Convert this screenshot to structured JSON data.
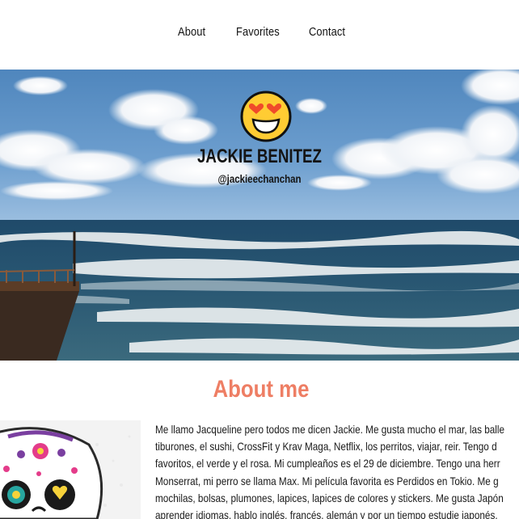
{
  "nav": {
    "items": [
      {
        "label": "About"
      },
      {
        "label": "Favorites"
      },
      {
        "label": "Contact"
      }
    ]
  },
  "hero": {
    "emoji": "heart-eyes-emoji",
    "name": "JACKIE BENITEZ",
    "handle": "@jackieechanchan"
  },
  "about": {
    "title": "About me",
    "lines": [
      "Me llamo Jacqueline pero todos me dicen Jackie. Me gusta mucho el mar, las balle",
      "tiburones, el sushi, CrossFit y Krav Maga, Netflix, los perritos, viajar, reir. Tengo d",
      "favoritos, el verde y el rosa. Mi cumpleaños es el 29 de diciembre. Tengo una herr",
      "Monserrat, mi perro se llama Max. Mi película favorita es Perdidos en Tokio. Me g",
      "mochilas, bolsas, plumones, lapices, lapices de colores y stickers. Me gusta Japón",
      "aprender idiomas, hablo inglés, francés, alemán y por un tiempo estudie japonés."
    ]
  },
  "colors": {
    "accent": "#ee7e64",
    "text": "#1a1a1a"
  }
}
